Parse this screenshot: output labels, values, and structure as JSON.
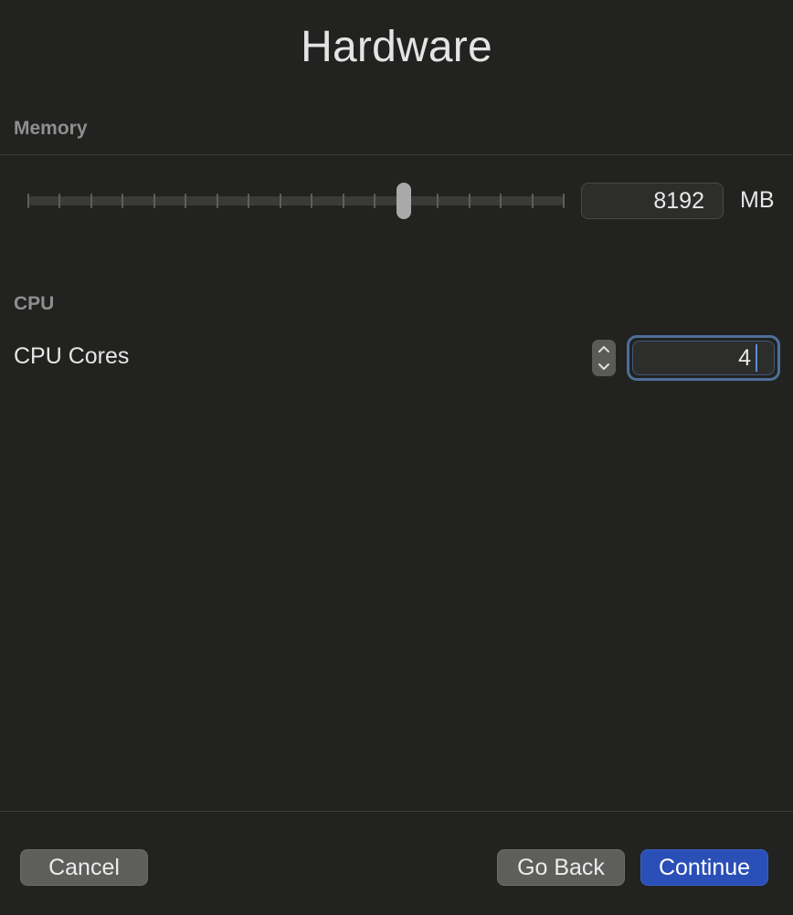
{
  "title": "Hardware",
  "memory": {
    "section_label": "Memory",
    "value": "8192",
    "unit": "MB",
    "slider_fraction": 0.702,
    "tick_count": 18
  },
  "cpu": {
    "section_label": "CPU",
    "cores_label": "CPU Cores",
    "cores_value": "4"
  },
  "buttons": {
    "cancel": "Cancel",
    "go_back": "Go Back",
    "continue": "Continue"
  },
  "colors": {
    "background": "#222220",
    "accent": "#2a4fb7",
    "focus_ring": "#4d6f99"
  }
}
